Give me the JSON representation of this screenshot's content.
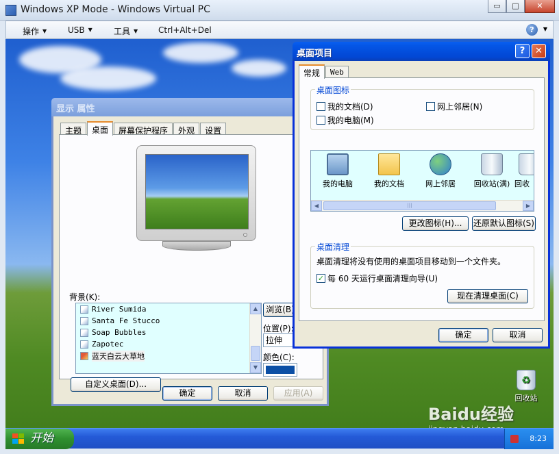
{
  "host": {
    "title": "Windows XP Mode - Windows Virtual PC",
    "controls": {
      "minimize": "▭",
      "maximize": "□",
      "close": "✕"
    },
    "menu": [
      {
        "label": "操作"
      },
      {
        "label": "USB"
      },
      {
        "label": "工具"
      },
      {
        "label": "Ctrl+Alt+Del"
      }
    ],
    "help": "?"
  },
  "display_props": {
    "title": "显示 属性",
    "tabs": [
      "主题",
      "桌面",
      "屏幕保护程序",
      "外观",
      "设置"
    ],
    "active_tab": "桌面",
    "background_label": "背景(K):",
    "backgrounds": [
      "River Sumida",
      "Santa Fe Stucco",
      "Soap Bubbles",
      "Zapotec",
      "蓝天白云大草地"
    ],
    "selected_background": "蓝天白云大草地",
    "browse_label": "浏览(B)",
    "position_label": "位置(P):",
    "position_value": "拉伸",
    "color_label": "颜色(C):",
    "color_value": "#0b4fa5",
    "customize_label": "自定义桌面(D)...",
    "ok": "确定",
    "cancel": "取消",
    "apply": "应用(A)"
  },
  "desktop_items": {
    "title": "桌面项目",
    "tabs": [
      "常规",
      "Web"
    ],
    "active_tab": "常规",
    "icons_group": "桌面图标",
    "checkboxes": [
      {
        "label": "我的文档(D)",
        "checked": false
      },
      {
        "label": "网上邻居(N)",
        "checked": false
      },
      {
        "label": "我的电脑(M)",
        "checked": false
      }
    ],
    "icon_list": [
      {
        "label": "我的电脑",
        "icon": "computer-icon"
      },
      {
        "label": "我的文档",
        "icon": "documents-icon"
      },
      {
        "label": "网上邻居",
        "icon": "network-icon"
      },
      {
        "label": "回收站(满)",
        "icon": "recycle-bin-full-icon"
      },
      {
        "label": "回收",
        "icon": "recycle-bin-empty-icon"
      }
    ],
    "change_icon": "更改图标(H)...",
    "restore_default": "还原默认图标(S)",
    "cleanup_group": "桌面清理",
    "cleanup_desc": "桌面清理将没有使用的桌面项目移动到一个文件夹。",
    "cleanup_checkbox": "每 60 天运行桌面清理向导(U)",
    "cleanup_checked": true,
    "cleanup_now": "现在清理桌面(C)",
    "ok": "确定",
    "cancel": "取消"
  },
  "desktop": {
    "recycle_bin_label": "回收站"
  },
  "taskbar": {
    "start_label": "开始",
    "clock": "8:23"
  },
  "watermark": {
    "brand": "Baidu经验",
    "url": "jingyan.baidu.com"
  }
}
